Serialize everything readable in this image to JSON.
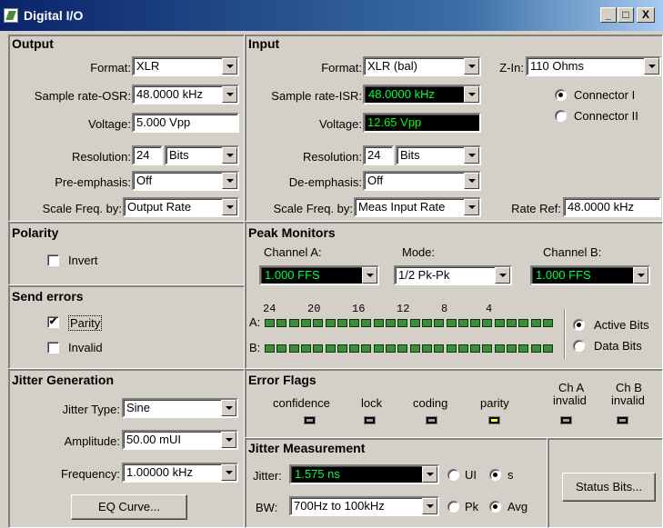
{
  "window": {
    "title": "Digital I/O",
    "min": "_",
    "max": "□",
    "close": "X"
  },
  "output": {
    "title": "Output",
    "format_label": "Format:",
    "format_value": "XLR",
    "rate_label": "Sample rate-OSR:",
    "rate_value": "48.0000 kHz",
    "voltage_label": "Voltage:",
    "voltage_value": "5.000  Vpp",
    "res_label": "Resolution:",
    "res_value": "24",
    "res_unit": "Bits",
    "pre_label": "Pre-emphasis:",
    "pre_value": "Off",
    "scale_label": "Scale Freq. by:",
    "scale_value": "Output Rate"
  },
  "input": {
    "title": "Input",
    "format_label": "Format:",
    "format_value": "XLR (bal)",
    "rate_label": "Sample rate-ISR:",
    "rate_value": "48.0000 kHz",
    "voltage_label": "Voltage:",
    "voltage_value": "12.65  Vpp",
    "res_label": "Resolution:",
    "res_value": "24",
    "res_unit": "Bits",
    "de_label": "De-emphasis:",
    "de_value": "Off",
    "scale_label": "Scale Freq. by:",
    "scale_value": "Meas Input Rate",
    "zin_label": "Z-In:",
    "zin_value": "110 Ohms",
    "conn1": "Connector I",
    "conn2": "Connector II",
    "rateref_label": "Rate Ref:",
    "rateref_value": "48.0000 kHz"
  },
  "polarity": {
    "title": "Polarity",
    "invert": "Invert"
  },
  "send_errors": {
    "title": "Send errors",
    "parity": "Parity",
    "invalid": "Invalid"
  },
  "peak": {
    "title": "Peak Monitors",
    "chA_label": "Channel A:",
    "chA_value": "1.000   FFS",
    "mode_label": "Mode:",
    "mode_value": "1/2 Pk-Pk",
    "chB_label": "Channel B:",
    "chB_value": "1.000   FFS",
    "scale": [
      "24",
      "20",
      "16",
      "12",
      "8",
      "4"
    ],
    "rowA": "A:",
    "rowB": "B:",
    "active": "Active Bits",
    "data": "Data Bits"
  },
  "jitter_gen": {
    "title": "Jitter Generation",
    "type_label": "Jitter Type:",
    "type_value": "Sine",
    "amp_label": "Amplitude:",
    "amp_value": "50.00  mUI",
    "freq_label": "Frequency:",
    "freq_value": "1.00000 kHz",
    "eq_button": "EQ Curve..."
  },
  "error_flags": {
    "title": "Error Flags",
    "flags": [
      "confidence",
      "lock",
      "coding",
      "parity"
    ],
    "chA1": "Ch A",
    "chA2": "invalid",
    "chB1": "Ch B",
    "chB2": "invalid"
  },
  "jitter_meas": {
    "title": "Jitter Measurement",
    "jitter_label": "Jitter:",
    "jitter_value": "1.575  ns",
    "ui": "UI",
    "s": "s",
    "bw_label": "BW:",
    "bw_value": "700Hz to 100kHz",
    "pk": "Pk",
    "avg": "Avg",
    "status_button": "Status Bits..."
  }
}
